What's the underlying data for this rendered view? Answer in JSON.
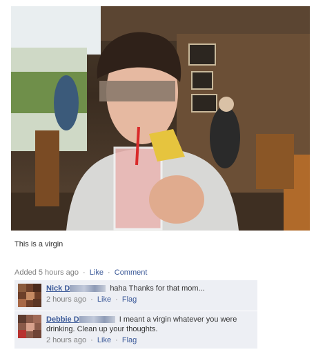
{
  "post": {
    "caption": "This is a virgin",
    "meta": {
      "added": "Added 5 hours ago",
      "like": "Like",
      "comment": "Comment"
    }
  },
  "comments": [
    {
      "author": "Nick D",
      "text": "haha Thanks for that mom...",
      "time": "2 hours ago",
      "like": "Like",
      "flag": "Flag"
    },
    {
      "author": "Debbie D",
      "text": "I meant a virgin whatever you were drinking. Clean up your thoughts.",
      "time": "2 hours ago",
      "like": "Like",
      "flag": "Flag"
    }
  ],
  "colors": {
    "link": "#3b5998",
    "comment_bg": "#edeff4",
    "meta_text": "#808080"
  }
}
